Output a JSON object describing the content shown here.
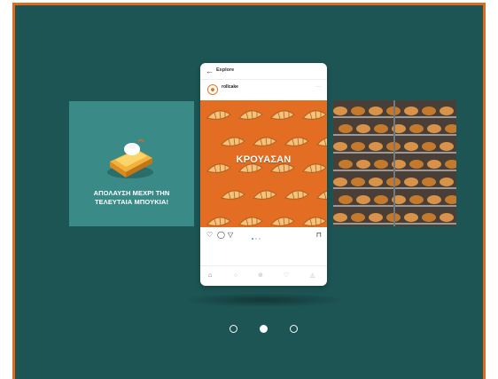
{
  "left_card": {
    "line1": "ΑΠΟΛΑΥΣΗ ΜΕΧΡΙ ΤΗΝ",
    "line2": "ΤΕΛΕΥΤΑΙΑ ΜΠΟΥΚΙΑ!"
  },
  "phone": {
    "back_icon": "←",
    "header": "Explore",
    "username": "rollcake",
    "sub_username": "",
    "more_icon": "···",
    "post_text": "ΚΡΟΥΑΣΑΝ",
    "likes": "",
    "caption": "",
    "time": "",
    "actions": {
      "like": "♡",
      "comment": "◯",
      "share": "▽",
      "save": "⊓"
    },
    "nav": {
      "home": "⌂",
      "search": "○",
      "add": "⊕",
      "activity": "♡",
      "profile": "◬"
    }
  },
  "pager": {
    "count": 3,
    "active_index": 1
  },
  "colors": {
    "background": "#1d5454",
    "accent": "#e06a1e",
    "left_card": "#3a8b87",
    "post": "#e36d22"
  }
}
